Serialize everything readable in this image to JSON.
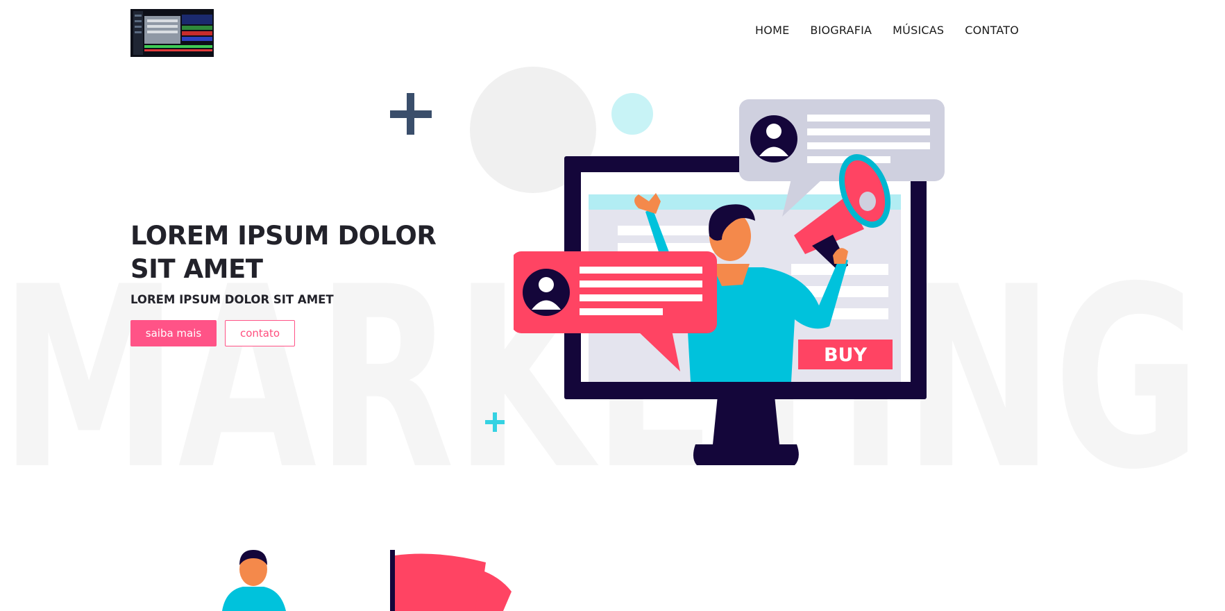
{
  "header": {
    "logo_alt": "logo",
    "nav": [
      {
        "label": "HOME"
      },
      {
        "label": "BIOGRAFIA"
      },
      {
        "label": "MÚSICAS"
      },
      {
        "label": "CONTATO"
      }
    ]
  },
  "hero": {
    "background_word": "MARKETING",
    "title": "LOREM IPSUM DOLOR SIT AMET",
    "subtitle": "LOREM IPSUM DOLOR SIT AMET",
    "primary_button": "saiba mais",
    "secondary_button": "contato"
  },
  "illustration": {
    "buy_label": "BUY"
  },
  "colors": {
    "accent": "#ff5387",
    "navy": "#14063a",
    "cyan": "#00c2dc",
    "red": "#ff4463",
    "plus_dark": "#3a4e6b"
  }
}
